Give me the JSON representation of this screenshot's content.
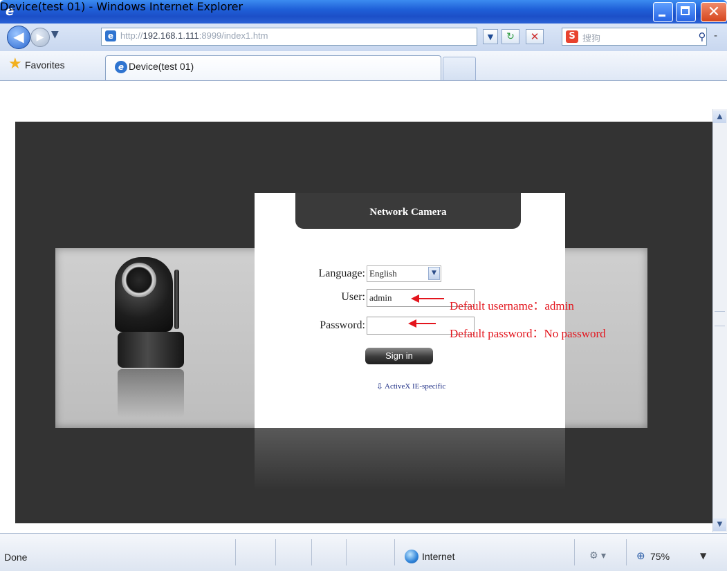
{
  "window": {
    "title": "Device(test 01) - Windows Internet Explorer",
    "close_glyph": "✕"
  },
  "toolbar": {
    "address_url_dim": "http://",
    "address_url_host": "192.168.1.111",
    "address_url_rest": ":8999/index1.htm",
    "search_placeholder": "搜狗",
    "search_provider_glyph": "S",
    "back_glyph": "◀",
    "forward_glyph": "▶",
    "dropdown_glyph": "▼",
    "refresh_glyph": "↻",
    "stop_glyph": "✕",
    "search_go_glyph": "⚲"
  },
  "favorites": {
    "label": "Favorites",
    "tab_label": "Device(test 01)"
  },
  "login": {
    "title": "Network Camera",
    "language_label": "Language:",
    "language_value": "English",
    "user_label": "User:",
    "user_value": "admin",
    "password_label": "Password:",
    "password_value": "",
    "signin_label": "Sign in",
    "activex_label": "ActiveX IE-specific"
  },
  "annotations": {
    "username_note": "Default username：admin",
    "password_note": "Default password：No password"
  },
  "status": {
    "text": "Done",
    "zone": "Internet",
    "zoom": "75%"
  },
  "colors": {
    "annotation": "#e3151d",
    "panel_dark": "#333333",
    "title_bar": "#1f5fd8"
  }
}
